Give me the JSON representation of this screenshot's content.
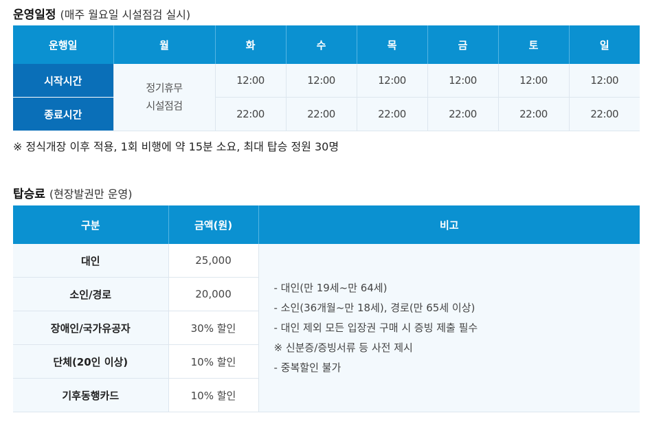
{
  "schedule": {
    "title": "운영일정",
    "subtitle": "(매주 월요일 시설점검 실시)",
    "header": [
      "운행일",
      "월",
      "화",
      "수",
      "목",
      "금",
      "토",
      "일"
    ],
    "closed_line1": "정기휴무",
    "closed_line2": "시설점검",
    "rows": [
      {
        "label": "시작시간",
        "times": [
          "12:00",
          "12:00",
          "12:00",
          "12:00",
          "12:00",
          "12:00"
        ]
      },
      {
        "label": "종료시간",
        "times": [
          "22:00",
          "22:00",
          "22:00",
          "22:00",
          "22:00",
          "22:00"
        ]
      }
    ],
    "note": "※ 정식개장 이후 적용, 1회 비행에 약 15분 소요, 최대 탑승 정원 30명"
  },
  "fares": {
    "title": "탑승료",
    "subtitle": "(현장발권만 운영)",
    "header": [
      "구분",
      "금액(원)",
      "비고"
    ],
    "rows": [
      {
        "category": "대인",
        "price": "25,000"
      },
      {
        "category": "소인/경로",
        "price": "20,000"
      },
      {
        "category": "장애인/국가유공자",
        "price": "30% 할인"
      },
      {
        "category": "단체(20인 이상)",
        "price": "10% 할인"
      },
      {
        "category": "기후동행카드",
        "price": "10% 할인"
      }
    ],
    "remarks": [
      "- 대인(만 19세~만 64세)",
      "- 소인(36개월~만 18세), 경로(만 65세 이상)",
      "- 대인 제외 모든 입장권 구매 시 증빙 제출 필수",
      "※ 신분증/증빙서류 등 사전 제시",
      "- 중복할인 불가"
    ]
  },
  "colors": {
    "header_blue": "#0b91d1",
    "row_header_blue": "#0a6fb8",
    "cell_bg": "#f3f9fd"
  }
}
